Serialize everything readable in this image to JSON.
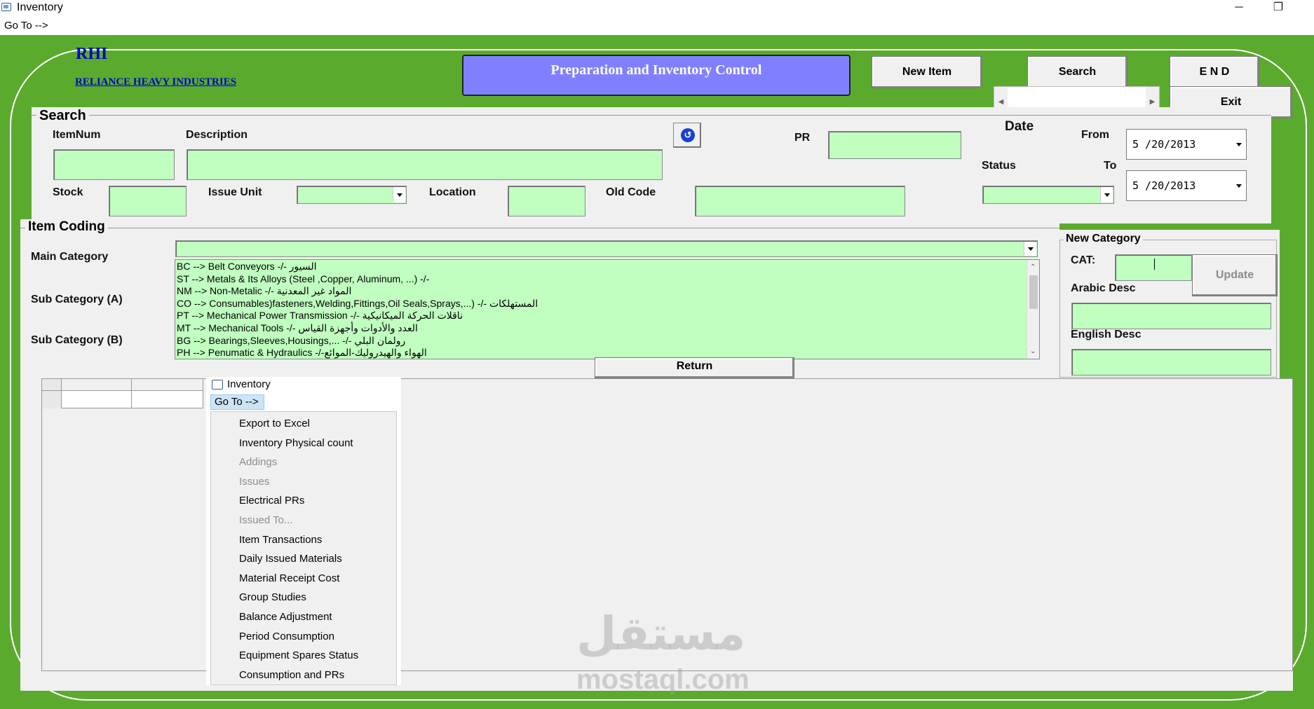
{
  "window": {
    "title": "Inventory",
    "menu_goto": "Go To -->",
    "minimize_glyph": "─",
    "restore_glyph": "❐"
  },
  "header": {
    "brand_short": "RHI",
    "brand_long": "RELIANCE HEAVY INDUSTRIES",
    "banner": "Preparation and Inventory Control",
    "new_item": "New Item",
    "search": "Search",
    "end": "E N D",
    "exit": "Exit"
  },
  "search": {
    "group_title": "Search",
    "itemnum_label": "ItemNum",
    "description_label": "Description",
    "pr_label": "PR",
    "date_label": "Date",
    "from_label": "From",
    "to_label": "To",
    "status_label": "Status",
    "stock_label": "Stock",
    "issue_unit_label": "Issue Unit",
    "location_label": "Location",
    "old_code_label": "Old Code",
    "from_date": "5 /20/2013",
    "to_date": "5 /20/2013"
  },
  "coding": {
    "group_title": "Item Coding",
    "main_category": "Main Category",
    "sub_a": "Sub Category (A)",
    "sub_b": "Sub Category (B)",
    "list": [
      "BC --> Belt Conveyors -/- السيور",
      "ST --> Metals & Its Alloys (Steel ,Copper, Aluminum, ...) -/-",
      "NM --> Non-Metalic -/- المواد غير المعدنية",
      "CO --> Consumables)fasteners,Welding,Fittings,Oil Seals,Sprays,...) -/- المستهلكات",
      "PT --> Mechanical Power Transmission -/- ناقلات الحركة الميكانيكية",
      "MT --> Mechanical Tools -/- العدد والأدوات وأجهزة القياس",
      "BG --> Bearings,Sleeves,Housings,... -/- رولمان البلي",
      "PH --> Penumatic & Hydraulics -/-الهواء والهيدروليك-الموائع"
    ],
    "return": "Return"
  },
  "new_category": {
    "group_title": "New Category",
    "cat_label": "CAT:",
    "update": "Update",
    "arabic_label": "Arabic Desc",
    "english_label": "English Desc"
  },
  "popup": {
    "title": "Inventory",
    "goto": "Go To -->",
    "items": [
      {
        "label": "Export to Excel",
        "enabled": true
      },
      {
        "label": "Inventory Physical count",
        "enabled": true
      },
      {
        "label": "Addings",
        "enabled": false
      },
      {
        "label": "Issues",
        "enabled": false
      },
      {
        "label": "Electrical PRs",
        "enabled": true
      },
      {
        "label": "Issued To...",
        "enabled": false
      },
      {
        "label": "Item Transactions",
        "enabled": true
      },
      {
        "label": "Daily Issued Materials",
        "enabled": true
      },
      {
        "label": "Material Receipt Cost",
        "enabled": true
      },
      {
        "label": "Group Studies",
        "enabled": true
      },
      {
        "label": "Balance Adjustment",
        "enabled": true
      },
      {
        "label": "Period Consumption",
        "enabled": true
      },
      {
        "label": "Equipment Spares Status",
        "enabled": true
      },
      {
        "label": "Consumption and PRs",
        "enabled": true
      }
    ]
  },
  "watermark": {
    "arabic": "مستقل",
    "latin": "mostaql.com"
  },
  "colors": {
    "background_green": "#5aab2d",
    "field_green": "#c0ffc0",
    "banner": "#8080ff",
    "brand": "#0000cc"
  }
}
